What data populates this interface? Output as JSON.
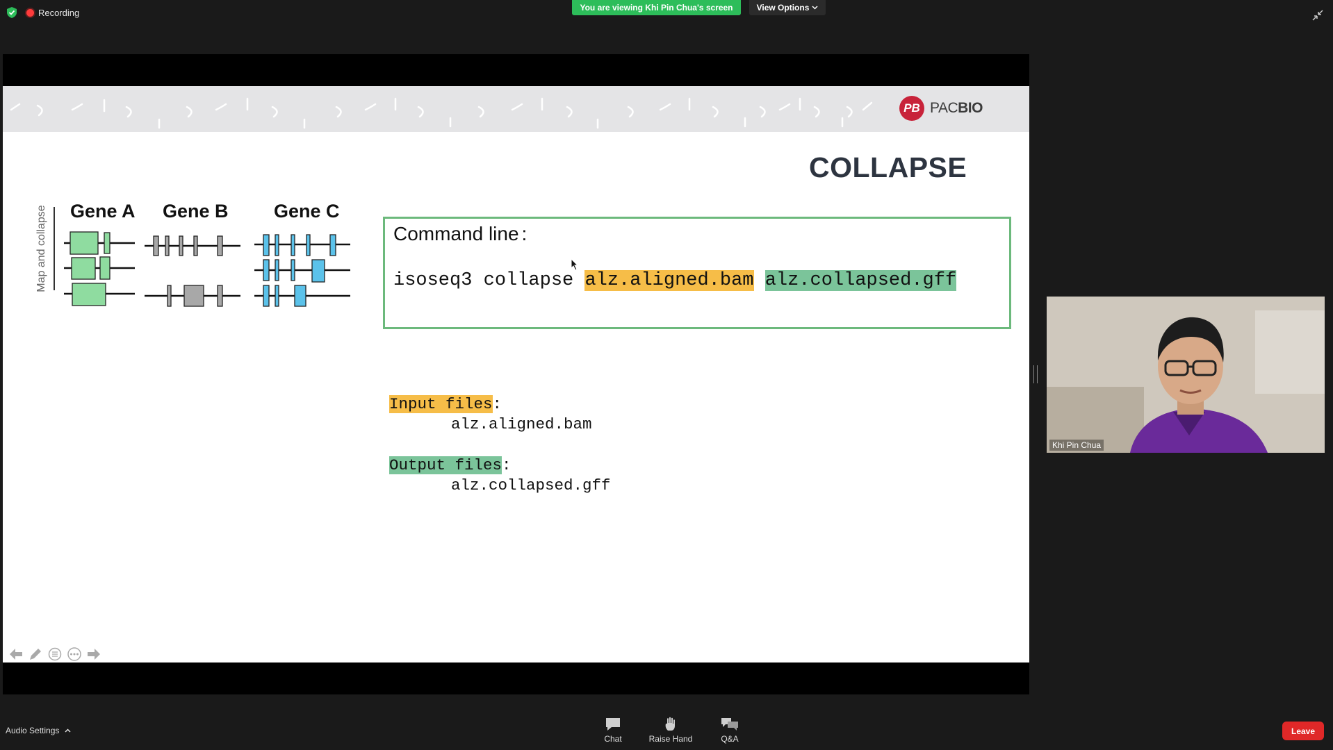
{
  "meeting": {
    "recording_label": "Recording",
    "viewing_banner": "You are viewing Khi Pin Chua's screen",
    "view_options_label": "View Options"
  },
  "slide": {
    "brand": {
      "prefix": "PAC",
      "suffix": "BIO",
      "mark_letters": "PB"
    },
    "title": "COLLAPSE",
    "diagram": {
      "side_label": "Map and collapse",
      "genes": [
        "Gene A",
        "Gene B",
        "Gene C"
      ]
    },
    "command": {
      "label": "Command line",
      "label_colon": ":",
      "tool": "isoseq3 collapse ",
      "input_arg": "alz.aligned.bam",
      "output_arg": "alz.collapsed.gff"
    },
    "io": {
      "input_label": "Input files",
      "input_file": "alz.aligned.bam",
      "output_label": "Output files",
      "output_file": "alz.collapsed.gff"
    }
  },
  "video": {
    "participant_name": "Khi Pin Chua"
  },
  "toolbar": {
    "audio_settings_label": "Audio Settings",
    "chat_label": "Chat",
    "raise_hand_label": "Raise Hand",
    "qa_label": "Q&A",
    "leave_label": "Leave"
  },
  "colors": {
    "banner_green": "#2dbd5a",
    "leave_red": "#e02828",
    "highlight_orange": "#f6bd48",
    "highlight_green": "#7bc49a",
    "gene_a": "#8fdca0",
    "gene_b": "#a8a8a8",
    "gene_c": "#5bc2ea"
  },
  "icons": [
    "shield-icon",
    "recording-dot-icon",
    "chevron-down-icon",
    "exit-fullscreen-icon",
    "chat-icon",
    "raise-hand-icon",
    "qa-icon",
    "arrow-left-icon",
    "pen-icon",
    "menu-icon",
    "more-icon",
    "arrow-right-icon"
  ]
}
